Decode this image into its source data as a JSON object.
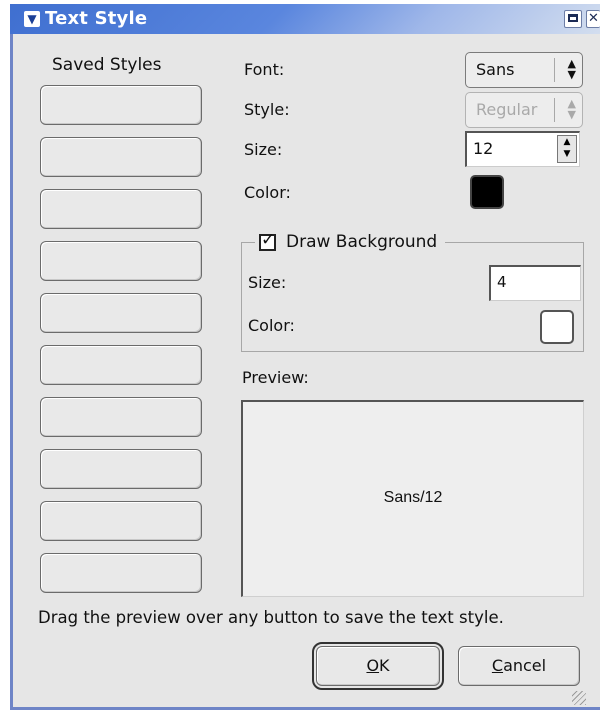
{
  "window": {
    "title": "Text Style",
    "accent": "#3f6fd0",
    "icons": {
      "menu": "chevron-down-icon",
      "maximize": "maximize-icon",
      "close": "close-icon"
    }
  },
  "saved_styles": {
    "title": "Saved Styles",
    "slot_count": 10
  },
  "font": {
    "label": "Font:",
    "value": "Sans"
  },
  "style": {
    "label": "Style:",
    "value": "Regular",
    "disabled": true
  },
  "size": {
    "label": "Size:",
    "value": "12"
  },
  "color": {
    "label": "Color:",
    "value": "#000000"
  },
  "background": {
    "toggle_label": "Draw Background",
    "checked": true,
    "size_label": "Size:",
    "size_value": "4",
    "color_label": "Color:",
    "color_value": "#ffffff"
  },
  "preview": {
    "label": "Preview:",
    "text": "Sans/12"
  },
  "hint": "Drag the preview over any button to save the text style.",
  "buttons": {
    "ok_mnemonic": "O",
    "ok_rest": "K",
    "cancel_mnemonic": "C",
    "cancel_rest": "ancel"
  }
}
